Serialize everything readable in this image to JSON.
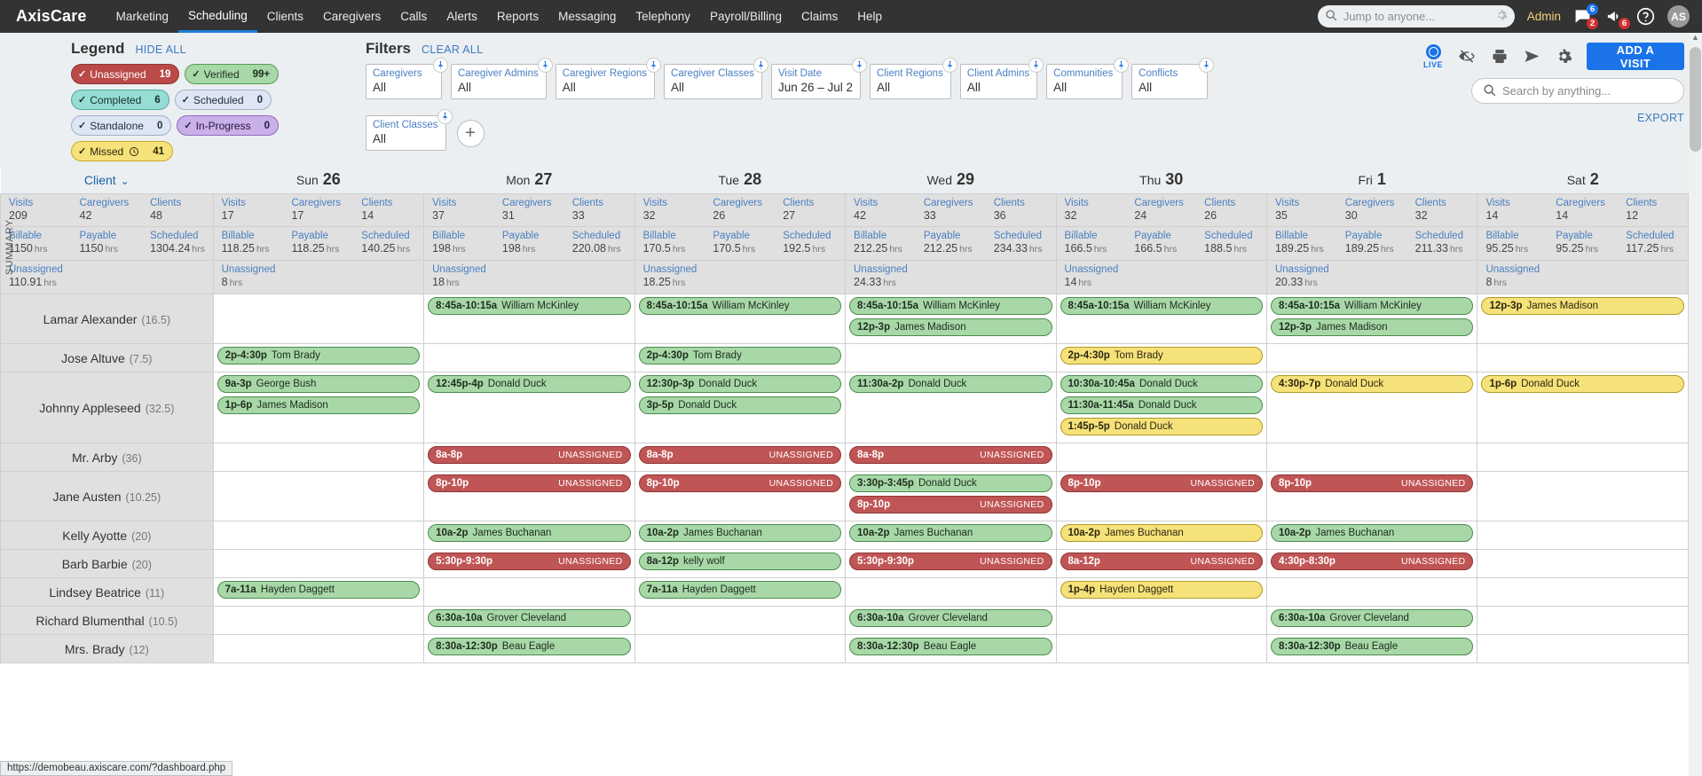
{
  "app": {
    "brand": "AxisCare"
  },
  "nav": {
    "items": [
      "Marketing",
      "Scheduling",
      "Clients",
      "Caregivers",
      "Calls",
      "Alerts",
      "Reports",
      "Messaging",
      "Telephony",
      "Payroll/Billing",
      "Claims",
      "Help"
    ],
    "active": "Scheduling",
    "jump_placeholder": "Jump to anyone...",
    "admin_label": "Admin",
    "messages_badge_blue": "6",
    "messages_badge_red": "2",
    "announce_badge_red": "6",
    "avatar_initials": "AS"
  },
  "legend": {
    "title": "Legend",
    "hide_all": "HIDE ALL",
    "items": [
      {
        "label": "Unassigned",
        "count": "19",
        "style": "unassigned"
      },
      {
        "label": "Verified",
        "count": "99+",
        "style": "verified"
      },
      {
        "label": "Completed",
        "count": "6",
        "style": "completed"
      },
      {
        "label": "Scheduled",
        "count": "0",
        "style": "scheduled"
      },
      {
        "label": "Standalone",
        "count": "0",
        "style": "standalone"
      },
      {
        "label": "In-Progress",
        "count": "0",
        "style": "inprogress"
      },
      {
        "label": "Missed",
        "count": "41",
        "style": "missed",
        "clock": true
      }
    ]
  },
  "filters": {
    "title": "Filters",
    "clear_all": "CLEAR ALL",
    "items": [
      {
        "label": "Caregivers",
        "value": "All"
      },
      {
        "label": "Caregiver Admins",
        "value": "All"
      },
      {
        "label": "Caregiver Regions",
        "value": "All"
      },
      {
        "label": "Caregiver Classes",
        "value": "All"
      },
      {
        "label": "Visit Date",
        "value": "Jun 26 – Jul 2"
      },
      {
        "label": "Client Regions",
        "value": "All"
      },
      {
        "label": "Client Admins",
        "value": "All"
      },
      {
        "label": "Communities",
        "value": "All"
      },
      {
        "label": "Conflicts",
        "value": "All"
      },
      {
        "label": "Client Classes",
        "value": "All"
      }
    ],
    "add_filter": "+"
  },
  "toolbar": {
    "live_label": "LIVE",
    "add_visit": "ADD A VISIT",
    "search_placeholder": "Search by anything...",
    "export": "EXPORT",
    "accent": "#1a73e8"
  },
  "grid": {
    "summary_tag": "SUMMARY",
    "client_column_label": "Client",
    "metric_labels_a": [
      "Visits",
      "Caregivers",
      "Clients"
    ],
    "metric_labels_b": [
      "Billable",
      "Payable",
      "Scheduled"
    ],
    "unassigned_label": "Unassigned",
    "hrs_unit": "hrs",
    "days": [
      {
        "dow": "Sun",
        "dnum": "26"
      },
      {
        "dow": "Mon",
        "dnum": "27"
      },
      {
        "dow": "Tue",
        "dnum": "28"
      },
      {
        "dow": "Wed",
        "dnum": "29"
      },
      {
        "dow": "Thu",
        "dnum": "30"
      },
      {
        "dow": "Fri",
        "dnum": "1"
      },
      {
        "dow": "Sat",
        "dnum": "2"
      }
    ],
    "summary": [
      {
        "visits": "209",
        "caregivers": "42",
        "clients": "48",
        "billable": "1150",
        "payable": "1150",
        "scheduled": "1304.24",
        "unassigned": "110.91"
      },
      {
        "visits": "17",
        "caregivers": "17",
        "clients": "14",
        "billable": "118.25",
        "payable": "118.25",
        "scheduled": "140.25",
        "unassigned": "8"
      },
      {
        "visits": "37",
        "caregivers": "31",
        "clients": "33",
        "billable": "198",
        "payable": "198",
        "scheduled": "220.08",
        "unassigned": "18"
      },
      {
        "visits": "32",
        "caregivers": "26",
        "clients": "27",
        "billable": "170.5",
        "payable": "170.5",
        "scheduled": "192.5",
        "unassigned": "18.25"
      },
      {
        "visits": "42",
        "caregivers": "33",
        "clients": "36",
        "billable": "212.25",
        "payable": "212.25",
        "scheduled": "234.33",
        "unassigned": "24.33"
      },
      {
        "visits": "32",
        "caregivers": "24",
        "clients": "26",
        "billable": "166.5",
        "payable": "166.5",
        "scheduled": "188.5",
        "unassigned": "14"
      },
      {
        "visits": "35",
        "caregivers": "30",
        "clients": "32",
        "billable": "189.25",
        "payable": "189.25",
        "scheduled": "211.33",
        "unassigned": "20.33"
      },
      {
        "visits": "14",
        "caregivers": "14",
        "clients": "12",
        "billable": "95.25",
        "payable": "95.25",
        "scheduled": "117.25",
        "unassigned": "8"
      }
    ],
    "unassigned_text": "UNASSIGNED",
    "rows": [
      {
        "client": "Lamar Alexander",
        "hours": "(16.5)",
        "days": [
          [],
          [
            {
              "time": "8:45a-10:15a",
              "name": "William McKinley",
              "color": "green"
            }
          ],
          [
            {
              "time": "8:45a-10:15a",
              "name": "William McKinley",
              "color": "green"
            }
          ],
          [
            {
              "time": "8:45a-10:15a",
              "name": "William McKinley",
              "color": "green"
            },
            {
              "time": "12p-3p",
              "name": "James Madison",
              "color": "green"
            }
          ],
          [
            {
              "time": "8:45a-10:15a",
              "name": "William McKinley",
              "color": "green"
            }
          ],
          [
            {
              "time": "8:45a-10:15a",
              "name": "William McKinley",
              "color": "green"
            },
            {
              "time": "12p-3p",
              "name": "James Madison",
              "color": "green"
            }
          ],
          [
            {
              "time": "12p-3p",
              "name": "James Madison",
              "color": "yellow"
            }
          ]
        ]
      },
      {
        "client": "Jose Altuve",
        "hours": "(7.5)",
        "days": [
          [
            {
              "time": "2p-4:30p",
              "name": "Tom Brady",
              "color": "green"
            }
          ],
          [],
          [
            {
              "time": "2p-4:30p",
              "name": "Tom Brady",
              "color": "green"
            }
          ],
          [],
          [
            {
              "time": "2p-4:30p",
              "name": "Tom Brady",
              "color": "yellow"
            }
          ],
          [],
          []
        ]
      },
      {
        "client": "Johnny Appleseed",
        "hours": "(32.5)",
        "days": [
          [
            {
              "time": "9a-3p",
              "name": "George Bush",
              "color": "green"
            },
            {
              "time": "1p-6p",
              "name": "James Madison",
              "color": "green"
            }
          ],
          [
            {
              "time": "12:45p-4p",
              "name": "Donald Duck",
              "color": "green"
            }
          ],
          [
            {
              "time": "12:30p-3p",
              "name": "Donald Duck",
              "color": "green"
            },
            {
              "time": "3p-5p",
              "name": "Donald Duck",
              "color": "green"
            }
          ],
          [
            {
              "time": "11:30a-2p",
              "name": "Donald Duck",
              "color": "green"
            }
          ],
          [
            {
              "time": "10:30a-10:45a",
              "name": "Donald Duck",
              "color": "green"
            },
            {
              "time": "11:30a-11:45a",
              "name": "Donald Duck",
              "color": "green"
            },
            {
              "time": "1:45p-5p",
              "name": "Donald Duck",
              "color": "yellow"
            }
          ],
          [
            {
              "time": "4:30p-7p",
              "name": "Donald Duck",
              "color": "yellow"
            }
          ],
          [
            {
              "time": "1p-6p",
              "name": "Donald Duck",
              "color": "yellow"
            }
          ]
        ]
      },
      {
        "client": "Mr. Arby",
        "hours": "(36)",
        "days": [
          [],
          [
            {
              "time": "8a-8p",
              "name": "",
              "color": "red",
              "unassigned": true
            }
          ],
          [
            {
              "time": "8a-8p",
              "name": "",
              "color": "red",
              "unassigned": true
            }
          ],
          [
            {
              "time": "8a-8p",
              "name": "",
              "color": "red",
              "unassigned": true
            }
          ],
          [],
          [],
          []
        ]
      },
      {
        "client": "Jane Austen",
        "hours": "(10.25)",
        "days": [
          [],
          [
            {
              "time": "8p-10p",
              "name": "",
              "color": "red",
              "unassigned": true
            }
          ],
          [
            {
              "time": "8p-10p",
              "name": "",
              "color": "red",
              "unassigned": true
            }
          ],
          [
            {
              "time": "3:30p-3:45p",
              "name": "Donald Duck",
              "color": "green"
            },
            {
              "time": "8p-10p",
              "name": "",
              "color": "red",
              "unassigned": true
            }
          ],
          [
            {
              "time": "8p-10p",
              "name": "",
              "color": "red",
              "unassigned": true
            }
          ],
          [
            {
              "time": "8p-10p",
              "name": "",
              "color": "red",
              "unassigned": true
            }
          ],
          []
        ]
      },
      {
        "client": "Kelly Ayotte",
        "hours": "(20)",
        "days": [
          [],
          [
            {
              "time": "10a-2p",
              "name": "James Buchanan",
              "color": "green"
            }
          ],
          [
            {
              "time": "10a-2p",
              "name": "James Buchanan",
              "color": "green"
            }
          ],
          [
            {
              "time": "10a-2p",
              "name": "James Buchanan",
              "color": "green"
            }
          ],
          [
            {
              "time": "10a-2p",
              "name": "James Buchanan",
              "color": "yellow"
            }
          ],
          [
            {
              "time": "10a-2p",
              "name": "James Buchanan",
              "color": "green"
            }
          ],
          []
        ]
      },
      {
        "client": "Barb Barbie",
        "hours": "(20)",
        "days": [
          [],
          [
            {
              "time": "5:30p-9:30p",
              "name": "",
              "color": "red",
              "unassigned": true
            }
          ],
          [
            {
              "time": "8a-12p",
              "name": "kelly wolf",
              "color": "green"
            }
          ],
          [
            {
              "time": "5:30p-9:30p",
              "name": "",
              "color": "red",
              "unassigned": true
            }
          ],
          [
            {
              "time": "8a-12p",
              "name": "",
              "color": "red",
              "unassigned": true
            }
          ],
          [
            {
              "time": "4:30p-8:30p",
              "name": "",
              "color": "red",
              "unassigned": true
            }
          ],
          []
        ]
      },
      {
        "client": "Lindsey Beatrice",
        "hours": "(11)",
        "days": [
          [
            {
              "time": "7a-11a",
              "name": "Hayden Daggett",
              "color": "green"
            }
          ],
          [],
          [
            {
              "time": "7a-11a",
              "name": "Hayden Daggett",
              "color": "green"
            }
          ],
          [],
          [
            {
              "time": "1p-4p",
              "name": "Hayden Daggett",
              "color": "yellow"
            }
          ],
          [],
          []
        ]
      },
      {
        "client": "Richard Blumenthal",
        "hours": "(10.5)",
        "days": [
          [],
          [
            {
              "time": "6:30a-10a",
              "name": "Grover Cleveland",
              "color": "green"
            }
          ],
          [],
          [
            {
              "time": "6:30a-10a",
              "name": "Grover Cleveland",
              "color": "green"
            }
          ],
          [],
          [
            {
              "time": "6:30a-10a",
              "name": "Grover Cleveland",
              "color": "green"
            }
          ],
          []
        ]
      },
      {
        "client": "Mrs. Brady",
        "hours": "(12)",
        "days": [
          [],
          [
            {
              "time": "8:30a-12:30p",
              "name": "Beau Eagle",
              "color": "green"
            }
          ],
          [],
          [
            {
              "time": "8:30a-12:30p",
              "name": "Beau Eagle",
              "color": "green"
            }
          ],
          [],
          [
            {
              "time": "8:30a-12:30p",
              "name": "Beau Eagle",
              "color": "green"
            }
          ],
          []
        ]
      }
    ]
  },
  "statusbar": {
    "url": "https://demobeau.axiscare.com/?dashboard.php"
  }
}
